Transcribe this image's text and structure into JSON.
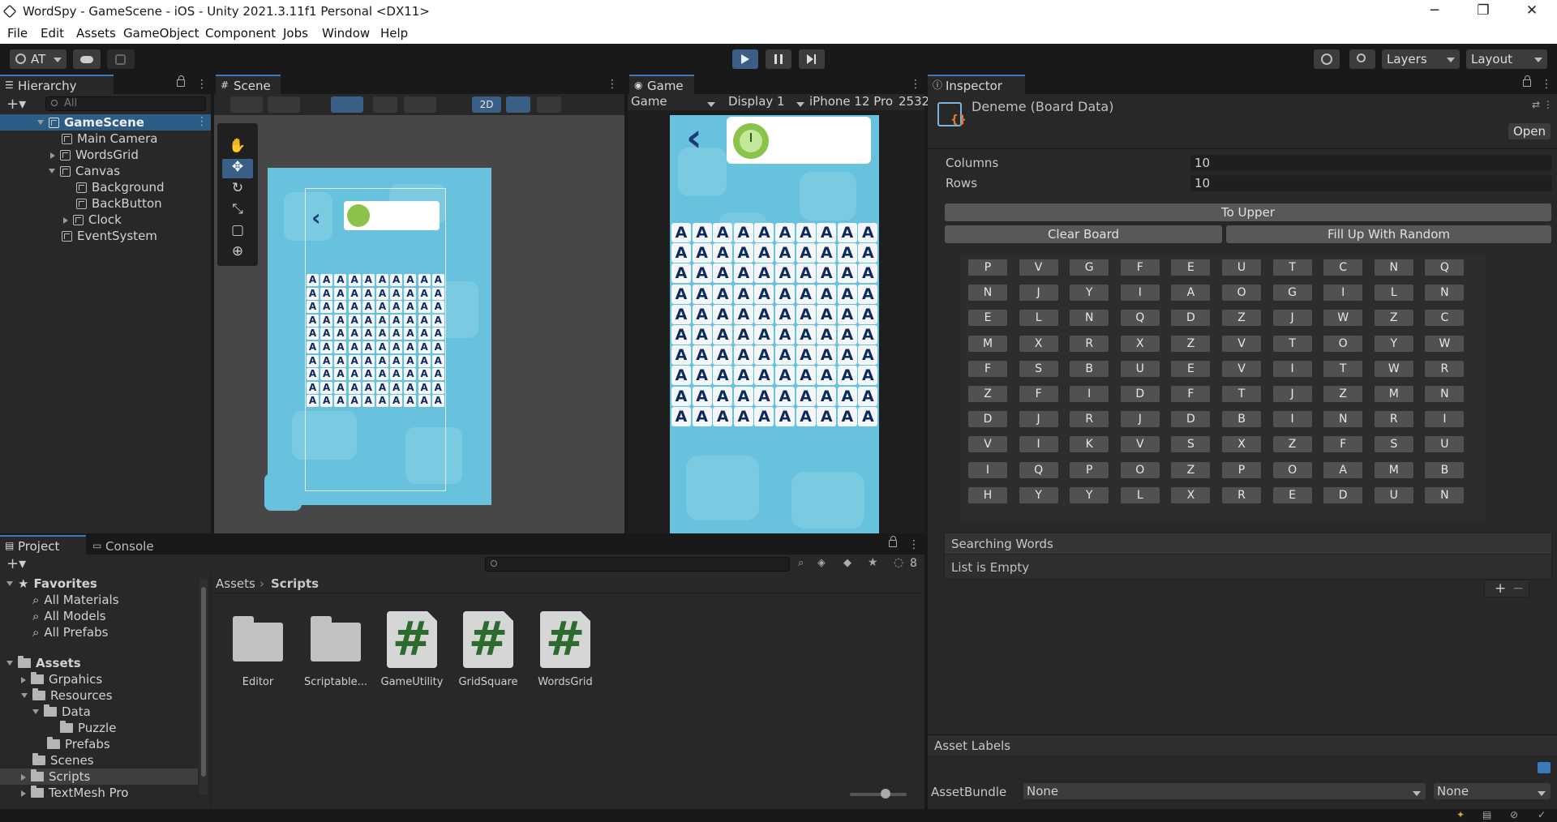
{
  "window": {
    "title": "WordSpy - GameScene - iOS - Unity 2021.3.11f1 Personal <DX11>",
    "controls": [
      "─",
      "❐",
      "✕"
    ]
  },
  "menu": [
    "File",
    "Edit",
    "Assets",
    "GameObject",
    "Component",
    "Jobs",
    "Window",
    "Help"
  ],
  "toolbar": {
    "account": "AT",
    "layers": "Layers",
    "layout": "Layout"
  },
  "hierarchy": {
    "tab": "Hierarchy",
    "search_placeholder": "All",
    "scene": "GameScene",
    "items": [
      {
        "label": "Main Camera"
      },
      {
        "label": "WordsGrid"
      },
      {
        "label": "Canvas"
      },
      {
        "label": "Background"
      },
      {
        "label": "BackButton"
      },
      {
        "label": "Clock"
      },
      {
        "label": "EventSystem"
      }
    ]
  },
  "scene_view": {
    "tab": "Scene",
    "mode_2d": "2D"
  },
  "game_view": {
    "tab": "Game",
    "mode": "Game",
    "display": "Display 1",
    "device": "iPhone 12 Pro",
    "resolution": "2532",
    "tile_letter": "A",
    "grid_rows": 10,
    "grid_cols": 10
  },
  "inspector": {
    "tab": "Inspector",
    "object_name": "Deneme (Board Data)",
    "open_button": "Open",
    "columns_label": "Columns",
    "columns_value": "10",
    "rows_label": "Rows",
    "rows_value": "10",
    "to_upper": "To Upper",
    "clear_board": "Clear Board",
    "fill_random": "Fill Up With Random",
    "board": [
      [
        "P",
        "V",
        "G",
        "F",
        "E",
        "U",
        "T",
        "C",
        "N",
        "Q"
      ],
      [
        "N",
        "J",
        "Y",
        "I",
        "A",
        "O",
        "G",
        "I",
        "L",
        "N"
      ],
      [
        "E",
        "L",
        "N",
        "Q",
        "D",
        "Z",
        "J",
        "W",
        "Z",
        "C"
      ],
      [
        "M",
        "X",
        "R",
        "X",
        "Z",
        "V",
        "T",
        "O",
        "Y",
        "W"
      ],
      [
        "F",
        "S",
        "B",
        "U",
        "E",
        "V",
        "I",
        "T",
        "W",
        "R"
      ],
      [
        "Z",
        "F",
        "I",
        "D",
        "F",
        "T",
        "J",
        "Z",
        "M",
        "N"
      ],
      [
        "D",
        "J",
        "R",
        "J",
        "D",
        "B",
        "I",
        "N",
        "R",
        "I"
      ],
      [
        "V",
        "I",
        "K",
        "V",
        "S",
        "X",
        "Z",
        "F",
        "S",
        "U"
      ],
      [
        "I",
        "Q",
        "P",
        "O",
        "Z",
        "P",
        "O",
        "A",
        "M",
        "B"
      ],
      [
        "H",
        "Y",
        "Y",
        "L",
        "X",
        "R",
        "E",
        "D",
        "U",
        "N"
      ]
    ],
    "searching_words": "Searching Words",
    "list_empty": "List is Empty",
    "asset_labels": "Asset Labels",
    "asset_bundle_label": "AssetBundle",
    "asset_bundle_value": "None",
    "asset_variant_value": "None"
  },
  "project": {
    "tab_project": "Project",
    "tab_console": "Console",
    "hidden_count": "8",
    "favorites": "Favorites",
    "fav_items": [
      "All Materials",
      "All Models",
      "All Prefabs"
    ],
    "assets": "Assets",
    "tree": [
      "Grpahics",
      "Resources",
      "Data",
      "Puzzle",
      "Prefabs",
      "Scenes",
      "Scripts",
      "TextMesh Pro"
    ],
    "breadcrumb_root": "Assets",
    "breadcrumb_current": "Scripts",
    "files": [
      {
        "name": "Editor",
        "kind": "folder"
      },
      {
        "name": "Scriptable...",
        "kind": "folder"
      },
      {
        "name": "GameUtility",
        "kind": "script"
      },
      {
        "name": "GridSquare",
        "kind": "script"
      },
      {
        "name": "WordsGrid",
        "kind": "script"
      }
    ]
  },
  "colors": {
    "accent": "#3a79bb",
    "game_bg": "#69c2dd",
    "tile_text": "#0d2a5c",
    "clock": "#8bc34a"
  }
}
